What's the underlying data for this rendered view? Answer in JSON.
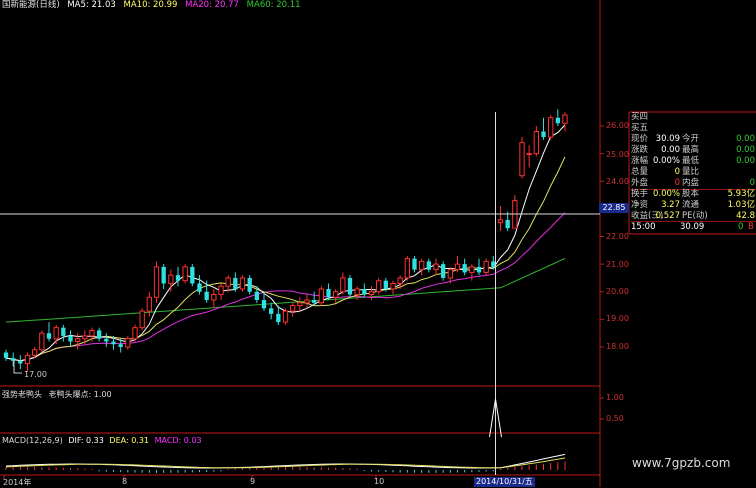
{
  "header": {
    "title": "国新能源(日线)",
    "ma5": "MA5: 21.03",
    "ma10": "MA10: 20.99",
    "ma20": "MA20: 20.77",
    "ma60": "MA60: 20.11",
    "colors": {
      "title": "#e0e0e0",
      "ma5": "#ffffff",
      "ma10": "#ffff66",
      "ma20": "#ff33ff",
      "ma60": "#33cc33"
    }
  },
  "price_axis": {
    "labels": [
      "26.00",
      "25.00",
      "24.00",
      "22.00",
      "21.00",
      "20.00",
      "19.00",
      "18.00"
    ],
    "crosshair_label": "22.85",
    "low_marker": "17.00"
  },
  "quote_panel": {
    "buy4": "买四",
    "buy5": "买五",
    "rows": [
      {
        "l": "现价",
        "v": "30.09",
        "l2": "今开",
        "v2": "0.00",
        "c": "#ffffff",
        "c2": "#33cc33"
      },
      {
        "l": "涨跌",
        "v": "0.00",
        "l2": "最高",
        "v2": "0.00",
        "c": "#ffffff",
        "c2": "#33cc33"
      },
      {
        "l": "涨幅",
        "v": "0.00%",
        "l2": "最低",
        "v2": "0.00",
        "c": "#ffffff",
        "c2": "#33cc33"
      },
      {
        "l": "总量",
        "v": "0",
        "l2": "量比",
        "v2": "",
        "c": "#ffff66",
        "c2": "#ffff66"
      },
      {
        "l": "外盘",
        "v": "0",
        "l2": "内盘",
        "v2": "0",
        "c": "#ff3333",
        "c2": "#33cc33"
      },
      {
        "l": "换手",
        "v": "0.00%",
        "l2": "股本",
        "v2": "5.93亿",
        "c": "#ffff66",
        "c2": "#ffff66"
      },
      {
        "l": "净资",
        "v": "3.27",
        "l2": "流通",
        "v2": "1.03亿",
        "c": "#ffff66",
        "c2": "#ffff66"
      },
      {
        "l": "收益(三)",
        "v": "0.527",
        "l2": "PE(动)",
        "v2": "42.8",
        "c": "#ffff66",
        "c2": "#ffff66"
      }
    ],
    "tick": {
      "time": "15:00",
      "price": "30.09",
      "vol": "0",
      "flag": "B"
    }
  },
  "indicator1": {
    "label": "强势老鸭头",
    "label2": "老鸭头爆点: 1.00",
    "axis": [
      "1.00",
      "0.50"
    ]
  },
  "macd": {
    "label": "MACD(12,26,9)",
    "dif": "DIF: 0.33",
    "dea": "DEA: 0.31",
    "macd": "MACD: 0.03"
  },
  "date_axis": {
    "labels": [
      "2014年",
      "8",
      "9",
      "10"
    ],
    "cursor_date": "2014/10/31/五"
  },
  "watermark": "www.7gpzb.com",
  "chart_data": {
    "type": "candlestick",
    "ylim": [
      16.5,
      26.5
    ],
    "candles": [
      [
        17.8,
        17.9,
        17.5,
        17.6
      ],
      [
        17.6,
        17.8,
        17.3,
        17.5
      ],
      [
        17.5,
        17.7,
        17.2,
        17.4
      ],
      [
        17.4,
        17.8,
        17.1,
        17.7
      ],
      [
        17.7,
        18.0,
        17.6,
        17.9
      ],
      [
        17.9,
        18.6,
        17.8,
        18.5
      ],
      [
        18.5,
        18.9,
        18.2,
        18.3
      ],
      [
        18.3,
        18.8,
        18.1,
        18.7
      ],
      [
        18.7,
        18.8,
        18.2,
        18.4
      ],
      [
        18.4,
        18.6,
        18.0,
        18.2
      ],
      [
        18.2,
        18.5,
        17.9,
        18.3
      ],
      [
        18.3,
        18.6,
        18.1,
        18.4
      ],
      [
        18.4,
        18.7,
        18.2,
        18.6
      ],
      [
        18.6,
        18.7,
        18.2,
        18.3
      ],
      [
        18.3,
        18.5,
        18.0,
        18.2
      ],
      [
        18.2,
        18.4,
        17.9,
        18.1
      ],
      [
        18.1,
        18.3,
        17.8,
        18.0
      ],
      [
        18.0,
        18.4,
        17.9,
        18.3
      ],
      [
        18.3,
        18.8,
        18.2,
        18.7
      ],
      [
        18.7,
        19.4,
        18.6,
        19.3
      ],
      [
        19.3,
        20.0,
        19.1,
        19.8
      ],
      [
        19.8,
        21.1,
        19.6,
        20.9
      ],
      [
        20.9,
        21.0,
        20.1,
        20.3
      ],
      [
        20.3,
        20.8,
        20.0,
        20.6
      ],
      [
        20.6,
        20.9,
        20.2,
        20.4
      ],
      [
        20.4,
        21.0,
        20.3,
        20.9
      ],
      [
        20.9,
        21.0,
        20.2,
        20.3
      ],
      [
        20.3,
        20.6,
        19.9,
        20.0
      ],
      [
        20.0,
        20.4,
        19.6,
        19.7
      ],
      [
        19.7,
        20.1,
        19.4,
        19.9
      ],
      [
        19.9,
        20.3,
        19.7,
        20.2
      ],
      [
        20.2,
        20.6,
        20.0,
        20.5
      ],
      [
        20.5,
        20.7,
        20.0,
        20.1
      ],
      [
        20.1,
        20.6,
        20.0,
        20.5
      ],
      [
        20.5,
        20.6,
        19.9,
        20.0
      ],
      [
        20.0,
        20.2,
        19.6,
        19.7
      ],
      [
        19.7,
        20.0,
        19.3,
        19.4
      ],
      [
        19.4,
        19.6,
        19.0,
        19.2
      ],
      [
        19.2,
        19.5,
        18.8,
        18.9
      ],
      [
        18.9,
        19.4,
        18.8,
        19.3
      ],
      [
        19.3,
        19.6,
        19.1,
        19.5
      ],
      [
        19.5,
        19.8,
        19.3,
        19.6
      ],
      [
        19.6,
        19.9,
        19.4,
        19.7
      ],
      [
        19.7,
        20.0,
        19.5,
        19.6
      ],
      [
        19.6,
        20.2,
        19.5,
        20.1
      ],
      [
        20.1,
        20.3,
        19.7,
        19.8
      ],
      [
        19.8,
        20.1,
        19.6,
        20.0
      ],
      [
        20.0,
        20.7,
        19.9,
        20.5
      ],
      [
        20.5,
        20.6,
        19.8,
        19.9
      ],
      [
        19.9,
        20.2,
        19.7,
        20.1
      ],
      [
        20.1,
        20.3,
        19.8,
        19.9
      ],
      [
        19.9,
        20.2,
        19.7,
        20.0
      ],
      [
        20.0,
        20.5,
        19.9,
        20.4
      ],
      [
        20.4,
        20.5,
        20.0,
        20.1
      ],
      [
        20.1,
        20.4,
        19.9,
        20.3
      ],
      [
        20.3,
        20.6,
        20.1,
        20.5
      ],
      [
        20.5,
        21.3,
        20.4,
        21.2
      ],
      [
        21.2,
        21.3,
        20.7,
        20.8
      ],
      [
        20.8,
        21.2,
        20.6,
        21.1
      ],
      [
        21.1,
        21.2,
        20.7,
        20.8
      ],
      [
        20.8,
        21.2,
        20.6,
        21.0
      ],
      [
        21.0,
        21.1,
        20.4,
        20.5
      ],
      [
        20.5,
        20.9,
        20.3,
        20.8
      ],
      [
        20.8,
        21.3,
        20.7,
        21.0
      ],
      [
        21.0,
        21.2,
        20.6,
        20.7
      ],
      [
        20.7,
        21.0,
        20.4,
        20.9
      ],
      [
        20.9,
        21.2,
        20.6,
        20.7
      ],
      [
        20.7,
        21.2,
        20.6,
        21.1
      ],
      [
        21.1,
        21.3,
        20.8,
        20.9
      ],
      [
        22.5,
        23.1,
        22.2,
        22.6
      ],
      [
        22.6,
        22.9,
        22.2,
        22.3
      ],
      [
        22.3,
        23.5,
        22.3,
        23.3
      ],
      [
        24.2,
        25.6,
        24.1,
        25.4
      ],
      [
        25.0,
        25.3,
        24.5,
        25.0
      ],
      [
        25.0,
        26.0,
        24.9,
        25.8
      ],
      [
        25.8,
        26.3,
        25.5,
        25.6
      ],
      [
        25.6,
        26.4,
        25.5,
        26.3
      ],
      [
        26.3,
        26.6,
        26.0,
        26.1
      ],
      [
        26.1,
        26.5,
        25.8,
        26.4
      ]
    ],
    "ma_start_index": 3
  }
}
